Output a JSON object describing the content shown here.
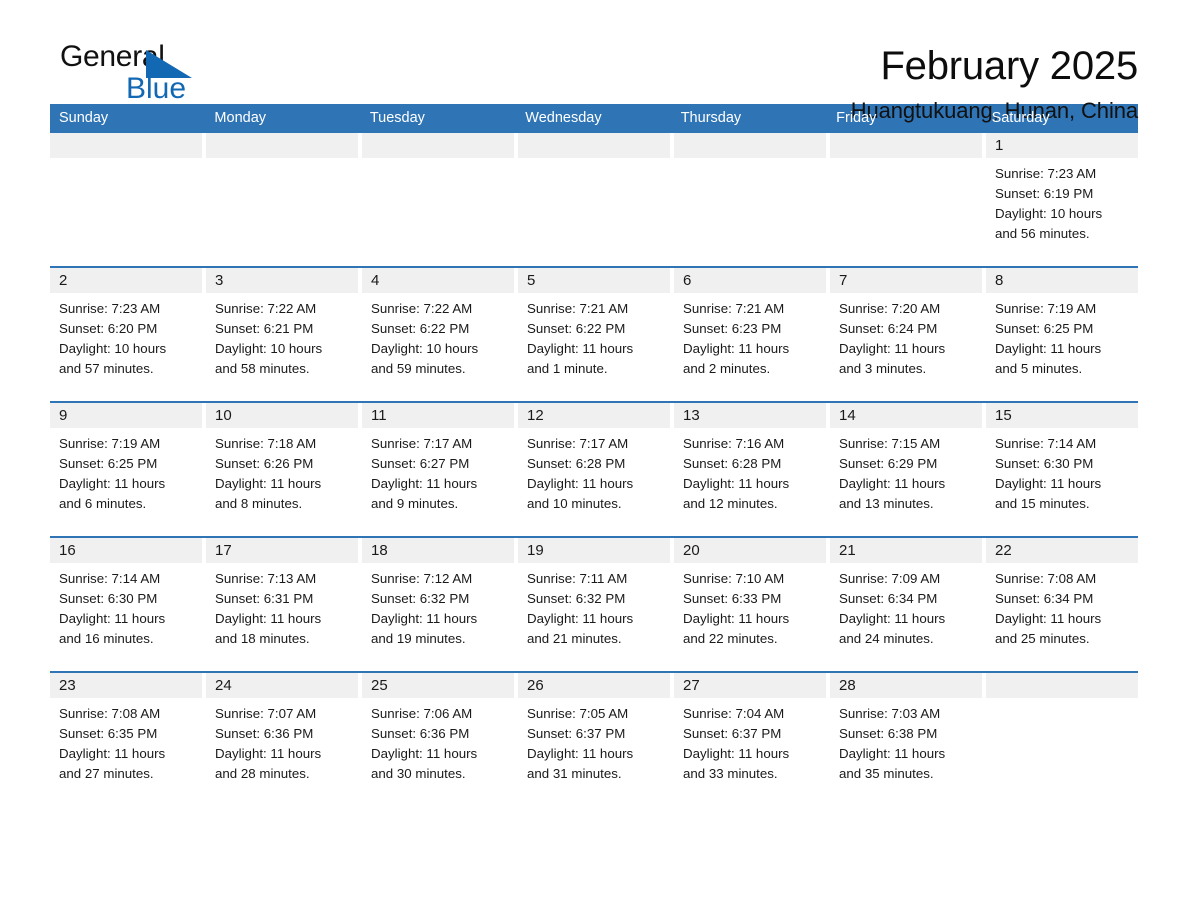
{
  "brand": {
    "logo_line1": "General",
    "logo_line2": "Blue",
    "logo_triangle_icon": "triangle-icon",
    "accent_color": "#2f74b5",
    "logo_blue_color": "#1268b3"
  },
  "header": {
    "title": "February 2025",
    "subtitle": "Huangtukuang, Hunan, China"
  },
  "weekdays": [
    "Sunday",
    "Monday",
    "Tuesday",
    "Wednesday",
    "Thursday",
    "Friday",
    "Saturday"
  ],
  "weeks": [
    [
      {
        "day": "",
        "sunrise": "",
        "sunset": "",
        "daylight1": "",
        "daylight2": ""
      },
      {
        "day": "",
        "sunrise": "",
        "sunset": "",
        "daylight1": "",
        "daylight2": ""
      },
      {
        "day": "",
        "sunrise": "",
        "sunset": "",
        "daylight1": "",
        "daylight2": ""
      },
      {
        "day": "",
        "sunrise": "",
        "sunset": "",
        "daylight1": "",
        "daylight2": ""
      },
      {
        "day": "",
        "sunrise": "",
        "sunset": "",
        "daylight1": "",
        "daylight2": ""
      },
      {
        "day": "",
        "sunrise": "",
        "sunset": "",
        "daylight1": "",
        "daylight2": ""
      },
      {
        "day": "1",
        "sunrise": "Sunrise: 7:23 AM",
        "sunset": "Sunset: 6:19 PM",
        "daylight1": "Daylight: 10 hours",
        "daylight2": "and 56 minutes."
      }
    ],
    [
      {
        "day": "2",
        "sunrise": "Sunrise: 7:23 AM",
        "sunset": "Sunset: 6:20 PM",
        "daylight1": "Daylight: 10 hours",
        "daylight2": "and 57 minutes."
      },
      {
        "day": "3",
        "sunrise": "Sunrise: 7:22 AM",
        "sunset": "Sunset: 6:21 PM",
        "daylight1": "Daylight: 10 hours",
        "daylight2": "and 58 minutes."
      },
      {
        "day": "4",
        "sunrise": "Sunrise: 7:22 AM",
        "sunset": "Sunset: 6:22 PM",
        "daylight1": "Daylight: 10 hours",
        "daylight2": "and 59 minutes."
      },
      {
        "day": "5",
        "sunrise": "Sunrise: 7:21 AM",
        "sunset": "Sunset: 6:22 PM",
        "daylight1": "Daylight: 11 hours",
        "daylight2": "and 1 minute."
      },
      {
        "day": "6",
        "sunrise": "Sunrise: 7:21 AM",
        "sunset": "Sunset: 6:23 PM",
        "daylight1": "Daylight: 11 hours",
        "daylight2": "and 2 minutes."
      },
      {
        "day": "7",
        "sunrise": "Sunrise: 7:20 AM",
        "sunset": "Sunset: 6:24 PM",
        "daylight1": "Daylight: 11 hours",
        "daylight2": "and 3 minutes."
      },
      {
        "day": "8",
        "sunrise": "Sunrise: 7:19 AM",
        "sunset": "Sunset: 6:25 PM",
        "daylight1": "Daylight: 11 hours",
        "daylight2": "and 5 minutes."
      }
    ],
    [
      {
        "day": "9",
        "sunrise": "Sunrise: 7:19 AM",
        "sunset": "Sunset: 6:25 PM",
        "daylight1": "Daylight: 11 hours",
        "daylight2": "and 6 minutes."
      },
      {
        "day": "10",
        "sunrise": "Sunrise: 7:18 AM",
        "sunset": "Sunset: 6:26 PM",
        "daylight1": "Daylight: 11 hours",
        "daylight2": "and 8 minutes."
      },
      {
        "day": "11",
        "sunrise": "Sunrise: 7:17 AM",
        "sunset": "Sunset: 6:27 PM",
        "daylight1": "Daylight: 11 hours",
        "daylight2": "and 9 minutes."
      },
      {
        "day": "12",
        "sunrise": "Sunrise: 7:17 AM",
        "sunset": "Sunset: 6:28 PM",
        "daylight1": "Daylight: 11 hours",
        "daylight2": "and 10 minutes."
      },
      {
        "day": "13",
        "sunrise": "Sunrise: 7:16 AM",
        "sunset": "Sunset: 6:28 PM",
        "daylight1": "Daylight: 11 hours",
        "daylight2": "and 12 minutes."
      },
      {
        "day": "14",
        "sunrise": "Sunrise: 7:15 AM",
        "sunset": "Sunset: 6:29 PM",
        "daylight1": "Daylight: 11 hours",
        "daylight2": "and 13 minutes."
      },
      {
        "day": "15",
        "sunrise": "Sunrise: 7:14 AM",
        "sunset": "Sunset: 6:30 PM",
        "daylight1": "Daylight: 11 hours",
        "daylight2": "and 15 minutes."
      }
    ],
    [
      {
        "day": "16",
        "sunrise": "Sunrise: 7:14 AM",
        "sunset": "Sunset: 6:30 PM",
        "daylight1": "Daylight: 11 hours",
        "daylight2": "and 16 minutes."
      },
      {
        "day": "17",
        "sunrise": "Sunrise: 7:13 AM",
        "sunset": "Sunset: 6:31 PM",
        "daylight1": "Daylight: 11 hours",
        "daylight2": "and 18 minutes."
      },
      {
        "day": "18",
        "sunrise": "Sunrise: 7:12 AM",
        "sunset": "Sunset: 6:32 PM",
        "daylight1": "Daylight: 11 hours",
        "daylight2": "and 19 minutes."
      },
      {
        "day": "19",
        "sunrise": "Sunrise: 7:11 AM",
        "sunset": "Sunset: 6:32 PM",
        "daylight1": "Daylight: 11 hours",
        "daylight2": "and 21 minutes."
      },
      {
        "day": "20",
        "sunrise": "Sunrise: 7:10 AM",
        "sunset": "Sunset: 6:33 PM",
        "daylight1": "Daylight: 11 hours",
        "daylight2": "and 22 minutes."
      },
      {
        "day": "21",
        "sunrise": "Sunrise: 7:09 AM",
        "sunset": "Sunset: 6:34 PM",
        "daylight1": "Daylight: 11 hours",
        "daylight2": "and 24 minutes."
      },
      {
        "day": "22",
        "sunrise": "Sunrise: 7:08 AM",
        "sunset": "Sunset: 6:34 PM",
        "daylight1": "Daylight: 11 hours",
        "daylight2": "and 25 minutes."
      }
    ],
    [
      {
        "day": "23",
        "sunrise": "Sunrise: 7:08 AM",
        "sunset": "Sunset: 6:35 PM",
        "daylight1": "Daylight: 11 hours",
        "daylight2": "and 27 minutes."
      },
      {
        "day": "24",
        "sunrise": "Sunrise: 7:07 AM",
        "sunset": "Sunset: 6:36 PM",
        "daylight1": "Daylight: 11 hours",
        "daylight2": "and 28 minutes."
      },
      {
        "day": "25",
        "sunrise": "Sunrise: 7:06 AM",
        "sunset": "Sunset: 6:36 PM",
        "daylight1": "Daylight: 11 hours",
        "daylight2": "and 30 minutes."
      },
      {
        "day": "26",
        "sunrise": "Sunrise: 7:05 AM",
        "sunset": "Sunset: 6:37 PM",
        "daylight1": "Daylight: 11 hours",
        "daylight2": "and 31 minutes."
      },
      {
        "day": "27",
        "sunrise": "Sunrise: 7:04 AM",
        "sunset": "Sunset: 6:37 PM",
        "daylight1": "Daylight: 11 hours",
        "daylight2": "and 33 minutes."
      },
      {
        "day": "28",
        "sunrise": "Sunrise: 7:03 AM",
        "sunset": "Sunset: 6:38 PM",
        "daylight1": "Daylight: 11 hours",
        "daylight2": "and 35 minutes."
      },
      {
        "day": "",
        "sunrise": "",
        "sunset": "",
        "daylight1": "",
        "daylight2": ""
      }
    ]
  ]
}
